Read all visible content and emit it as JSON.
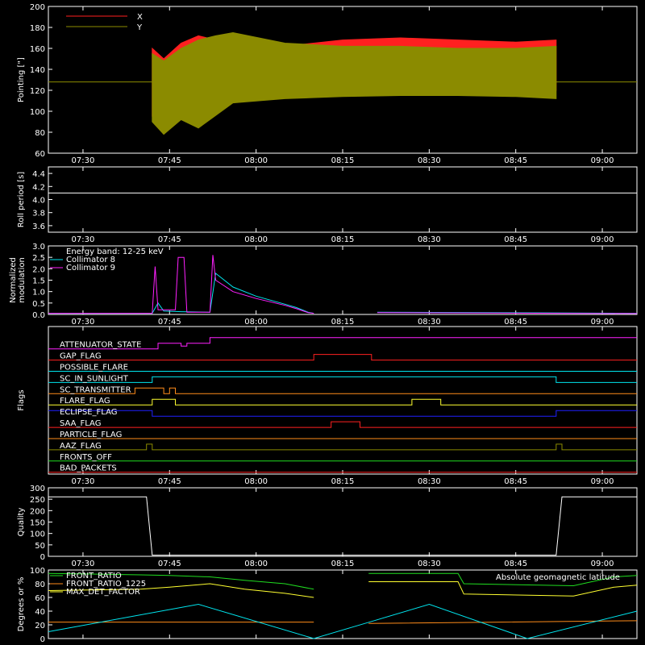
{
  "colors": {
    "bg": "#000000",
    "axis": "#ffffff",
    "red": "#ff2020",
    "olive": "#8b8b00",
    "white": "#ffffff",
    "cyan": "#00e5ee",
    "magenta": "#ff20ff",
    "green": "#20dd20",
    "yellow": "#ffff30",
    "orange": "#ff8c1a",
    "blue": "#2020ff"
  },
  "time_ticks": [
    "07:30",
    "07:45",
    "08:00",
    "08:15",
    "08:30",
    "08:45",
    "09:00"
  ],
  "chart_data": [
    {
      "id": "pointing",
      "type": "line",
      "ylabel": "Pointing [\"]",
      "ylim": [
        60,
        200
      ],
      "yticks": [
        "60",
        "80",
        "100",
        "120",
        "140",
        "160",
        "180",
        "200"
      ],
      "legend": [
        "X",
        "Y"
      ],
      "series": [
        {
          "name": "X",
          "color": "red",
          "kind": "envelope",
          "x": [
            "07:42",
            "07:44",
            "07:47",
            "07:50",
            "07:53",
            "07:56",
            "08:05",
            "08:15",
            "08:25",
            "08:35",
            "08:45",
            "08:52"
          ],
          "upper": [
            160,
            150,
            165,
            172,
            168,
            170,
            162,
            168,
            170,
            168,
            166,
            168
          ],
          "lower": [
            95,
            82,
            98,
            92,
            100,
            110,
            118,
            120,
            122,
            122,
            121,
            120
          ]
        },
        {
          "name": "Y",
          "color": "olive",
          "kind": "envelope",
          "x": [
            "07:42",
            "07:44",
            "07:47",
            "07:50",
            "07:53",
            "07:56",
            "08:05",
            "08:15",
            "08:25",
            "08:35",
            "08:45",
            "08:52"
          ],
          "upper": [
            155,
            148,
            160,
            168,
            172,
            175,
            165,
            162,
            162,
            160,
            160,
            162
          ],
          "lower": [
            90,
            78,
            92,
            84,
            96,
            108,
            112,
            114,
            115,
            115,
            114,
            112
          ],
          "flat_outside": 128
        }
      ]
    },
    {
      "id": "roll",
      "type": "line",
      "ylabel": "Roll period [s]",
      "ylim": [
        3.5,
        4.5
      ],
      "yticks": [
        "3.6",
        "3.8",
        "4.0",
        "4.2",
        "4.4"
      ],
      "series": [
        {
          "name": "",
          "color": "white",
          "x": [
            "07:24",
            "09:06"
          ],
          "y": [
            4.1,
            4.1
          ]
        }
      ]
    },
    {
      "id": "modulation",
      "type": "line",
      "ylabel": "Normalized modulation",
      "ylim": [
        0,
        3.0
      ],
      "yticks": [
        "0.0",
        "0.5",
        "1.0",
        "1.5",
        "2.0",
        "2.5",
        "3.0"
      ],
      "legend": [
        "Energy band: 12-25 keV",
        "Collimator 8",
        "Collimator 9"
      ],
      "series": [
        {
          "name": "Collimator 8",
          "color": "cyan",
          "x": [
            "07:24",
            "07:42",
            "07:43",
            "07:44",
            "07:47",
            "07:52",
            "07:53",
            "07:56",
            "08:00",
            "08:05",
            "08:07",
            "08:09",
            "08:10",
            "08:20",
            "08:21",
            "08:40",
            "09:06"
          ],
          "y": [
            0.05,
            0.05,
            0.5,
            0.15,
            0.12,
            0.1,
            1.8,
            1.2,
            0.8,
            0.45,
            0.3,
            0.1,
            0.05,
            null,
            0.1,
            0.08,
            0.05
          ]
        },
        {
          "name": "Collimator 9",
          "color": "magenta",
          "x": [
            "07:24",
            "07:42",
            "07:42.5",
            "07:43",
            "07:46",
            "07:46.5",
            "07:47.5",
            "07:48",
            "07:52",
            "07:52.5",
            "07:53",
            "07:56",
            "08:00",
            "08:05",
            "08:07",
            "08:09",
            "08:10",
            "08:20",
            "08:21",
            "08:40",
            "09:06"
          ],
          "y": [
            0.05,
            0.05,
            2.1,
            0.2,
            0.2,
            2.5,
            2.5,
            0.1,
            0.1,
            2.6,
            1.5,
            1.0,
            0.7,
            0.4,
            0.25,
            0.08,
            0.05,
            null,
            0.08,
            0.06,
            0.04
          ]
        }
      ]
    },
    {
      "id": "flags",
      "type": "line",
      "ylabel": "Flags",
      "series": [
        {
          "name": "ATTENUATOR_STATE",
          "color": "magenta",
          "steps": [
            [
              "07:24",
              0
            ],
            [
              "07:43",
              1
            ],
            [
              "07:47",
              0.5
            ],
            [
              "07:48",
              1
            ],
            [
              "07:52",
              2
            ],
            [
              "09:06",
              2
            ]
          ]
        },
        {
          "name": "GAP_FLAG",
          "color": "red",
          "steps": [
            [
              "07:24",
              0
            ],
            [
              "08:10",
              1
            ],
            [
              "08:20",
              0
            ],
            [
              "09:06",
              0
            ]
          ]
        },
        {
          "name": "POSSIBLE_FLARE",
          "color": "cyan",
          "steps": [
            [
              "07:24",
              0
            ],
            [
              "09:06",
              0
            ]
          ]
        },
        {
          "name": "SC_IN_SUNLIGHT",
          "color": "cyan",
          "steps": [
            [
              "07:24",
              0
            ],
            [
              "07:42",
              1
            ],
            [
              "08:52",
              0
            ],
            [
              "09:06",
              0
            ]
          ]
        },
        {
          "name": "SC_TRANSMITTER",
          "color": "orange",
          "steps": [
            [
              "07:24",
              0
            ],
            [
              "07:39",
              1
            ],
            [
              "07:44",
              0
            ],
            [
              "07:45",
              1
            ],
            [
              "07:46",
              0
            ],
            [
              "09:06",
              0
            ]
          ]
        },
        {
          "name": "FLARE_FLAG",
          "color": "yellow",
          "steps": [
            [
              "07:24",
              0
            ],
            [
              "07:42",
              1
            ],
            [
              "07:46",
              0
            ],
            [
              "08:27",
              1
            ],
            [
              "08:32",
              0
            ],
            [
              "09:06",
              0
            ]
          ]
        },
        {
          "name": "ECLIPSE_FLAG",
          "color": "blue",
          "steps": [
            [
              "07:24",
              1
            ],
            [
              "07:42",
              0
            ],
            [
              "08:52",
              1
            ],
            [
              "09:06",
              1
            ]
          ]
        },
        {
          "name": "SAA_FLAG",
          "color": "red",
          "steps": [
            [
              "07:24",
              0
            ],
            [
              "08:13",
              1
            ],
            [
              "08:18",
              0
            ],
            [
              "09:06",
              0
            ]
          ]
        },
        {
          "name": "PARTICLE_FLAG",
          "color": "orange",
          "steps": [
            [
              "07:24",
              0
            ],
            [
              "09:06",
              0
            ]
          ]
        },
        {
          "name": "AAZ_FLAG",
          "color": "olive",
          "steps": [
            [
              "07:24",
              0
            ],
            [
              "07:41",
              1
            ],
            [
              "07:42",
              0
            ],
            [
              "08:52",
              1
            ],
            [
              "08:53",
              0
            ],
            [
              "09:06",
              0
            ]
          ]
        },
        {
          "name": "FRONTS_OFF",
          "color": "green",
          "steps": [
            [
              "07:24",
              0
            ],
            [
              "09:06",
              0
            ]
          ]
        },
        {
          "name": "BAD_PACKETS",
          "color": "red",
          "steps": [
            [
              "07:24",
              0
            ],
            [
              "09:06",
              0
            ]
          ]
        }
      ]
    },
    {
      "id": "quality",
      "type": "line",
      "ylabel": "Quality",
      "ylim": [
        0,
        300
      ],
      "yticks": [
        "0",
        "50",
        "100",
        "150",
        "200",
        "250",
        "300"
      ],
      "series": [
        {
          "name": "",
          "color": "white",
          "x": [
            "07:24",
            "07:41",
            "07:42",
            "08:52",
            "08:53",
            "09:06"
          ],
          "y": [
            260,
            260,
            5,
            5,
            260,
            260
          ]
        }
      ]
    },
    {
      "id": "geo",
      "type": "line",
      "ylabel": "Degrees or %",
      "ylim": [
        0,
        100
      ],
      "yticks": [
        "0",
        "20",
        "40",
        "60",
        "80",
        "100"
      ],
      "legend": [
        "FRONT_RATIO",
        "FRONT_RATIO_1225",
        "MAX_DET_FACTOR",
        "Absolute geomagnetic latitude"
      ],
      "series": [
        {
          "name": "FRONT_RATIO",
          "color": "green",
          "x": [
            "07:24",
            "07:40",
            "07:45",
            "07:52",
            "07:58",
            "08:05",
            "08:10",
            "08:10.5",
            "08:19",
            "08:19.5",
            "08:35",
            "08:36",
            "08:55",
            "09:02",
            "09:06"
          ],
          "y": [
            95,
            93,
            92,
            90,
            85,
            80,
            72,
            null,
            null,
            95,
            95,
            80,
            77,
            90,
            92
          ]
        },
        {
          "name": "MAX_DET_FACTOR",
          "color": "yellow",
          "x": [
            "07:24",
            "07:40",
            "07:45",
            "07:52",
            "07:58",
            "08:05",
            "08:10",
            "08:10.5",
            "08:19",
            "08:19.5",
            "08:35",
            "08:36",
            "08:55",
            "09:02",
            "09:06"
          ],
          "y": [
            70,
            72,
            75,
            80,
            72,
            66,
            60,
            null,
            null,
            83,
            83,
            65,
            62,
            75,
            78
          ]
        },
        {
          "name": "FRONT_RATIO_1225",
          "color": "orange",
          "x": [
            "07:24",
            "08:10",
            "08:10.5",
            "08:19",
            "08:19.5",
            "09:06"
          ],
          "y": [
            24,
            24,
            null,
            null,
            22,
            26
          ]
        },
        {
          "name": "Absolute geomagnetic latitude",
          "color": "cyan",
          "x": [
            "07:24",
            "07:50",
            "08:10",
            "08:20",
            "08:30",
            "08:47",
            "09:06"
          ],
          "y": [
            10,
            50,
            0,
            25,
            50,
            0,
            40
          ]
        }
      ]
    }
  ]
}
